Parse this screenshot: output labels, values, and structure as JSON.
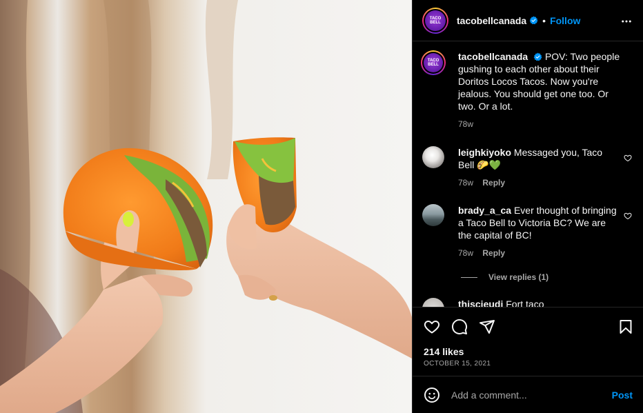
{
  "account": {
    "username": "tacobellcanada",
    "avatar_text": "TACO BELL",
    "verified": true,
    "separator": "•",
    "follow_label": "Follow"
  },
  "caption": {
    "username": "tacobellcanada",
    "text": "POV: Two people gushing to each other about their Doritos Locos Tacos. Now you're jealous. You should get one too. Or two. Or a lot.",
    "time": "78w"
  },
  "comments": [
    {
      "username": "leighkiyoko",
      "text": "Messaged you, Taco Bell 🌮💚",
      "time": "78w",
      "reply_label": "Reply"
    },
    {
      "username": "brady_a_ca",
      "text": "Ever thought of bringing a Taco Bell to Victoria BC? We are the capital of BC!",
      "time": "78w",
      "reply_label": "Reply"
    },
    {
      "username": "thiscieudi",
      "text": "Fort taco",
      "time": "",
      "reply_label": ""
    }
  ],
  "view_replies_label": "View replies (1)",
  "post_stats": {
    "likes": "214 likes",
    "date": "OCTOBER 15, 2021"
  },
  "comment_box": {
    "placeholder": "Add a comment...",
    "post_label": "Post"
  },
  "icons": {
    "more": "more-options-icon",
    "like": "heart-icon",
    "comment": "comment-icon",
    "share": "share-icon",
    "save": "bookmark-icon",
    "emoji": "emoji-icon",
    "verified": "verified-badge-icon"
  },
  "colors": {
    "background": "#000000",
    "text": "#f5f5f5",
    "secondary_text": "#a8a8a8",
    "link_blue": "#0095f6",
    "divider": "#262626",
    "taco_shell": "#f27b1a"
  }
}
